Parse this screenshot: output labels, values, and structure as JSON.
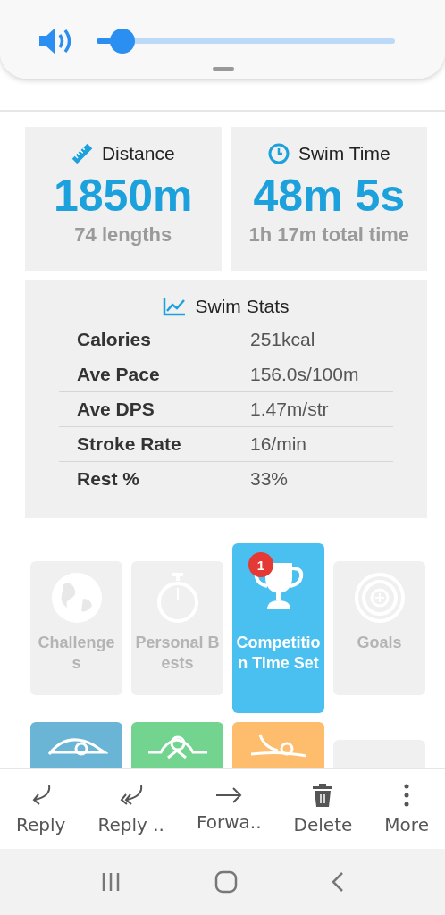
{
  "volume_panel": {
    "level": 0.05
  },
  "distance": {
    "label": "Distance",
    "value": "1850m",
    "sub": "74 lengths"
  },
  "swim_time": {
    "label": "Swim Time",
    "value": "48m 5s",
    "sub": "1h 17m total time"
  },
  "swim_stats": {
    "title": "Swim Stats",
    "rows": [
      {
        "name": "Calories",
        "value": "251kcal"
      },
      {
        "name": "Ave Pace",
        "value": "156.0s/100m"
      },
      {
        "name": "Ave DPS",
        "value": "1.47m/str"
      },
      {
        "name": "Stroke Rate",
        "value": "16/min"
      },
      {
        "name": "Rest %",
        "value": "33%"
      }
    ]
  },
  "tiles": [
    {
      "kind": "globe",
      "label": "Challenges",
      "selected": false
    },
    {
      "kind": "stopwatch",
      "label": "Personal Bests",
      "selected": false
    },
    {
      "kind": "trophy",
      "label": "Competition Time Set",
      "selected": true,
      "badge": "1"
    },
    {
      "kind": "target",
      "label": "Goals",
      "selected": false
    }
  ],
  "stroke_tiles": [
    {
      "kind": "freestyle",
      "color": "#6ab4d6"
    },
    {
      "kind": "breaststroke",
      "color": "#72d48e"
    },
    {
      "kind": "backstroke",
      "color": "#fdbd6c"
    },
    {
      "kind": "blank",
      "color": "#f0f0f0"
    }
  ],
  "actions": [
    {
      "kind": "reply",
      "label": "Reply"
    },
    {
      "kind": "reply_all",
      "label": "Reply .."
    },
    {
      "kind": "forward",
      "label": "Forwa.."
    },
    {
      "kind": "delete",
      "label": "Delete"
    },
    {
      "kind": "more",
      "label": "More"
    }
  ]
}
